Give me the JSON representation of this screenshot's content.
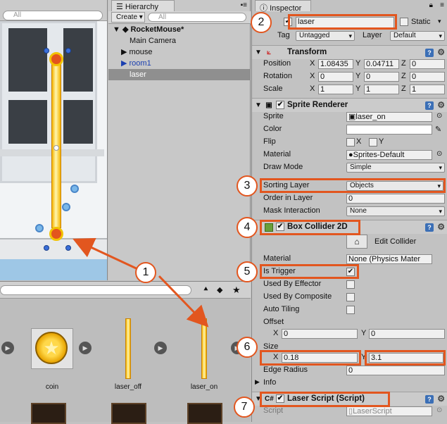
{
  "scene": {
    "search_placeholder": "All"
  },
  "hierarchy": {
    "tab": "Hierarchy",
    "create_label": "Create ▾",
    "search_placeholder": "All",
    "items": [
      {
        "label": "RocketMouse*"
      },
      {
        "label": "Main Camera"
      },
      {
        "label": "mouse"
      },
      {
        "label": "room1"
      },
      {
        "label": "laser"
      }
    ]
  },
  "project": {
    "assets": [
      {
        "label": "coin"
      },
      {
        "label": "laser_off"
      },
      {
        "label": "laser_on"
      }
    ]
  },
  "inspector": {
    "tab": "Inspector",
    "name": "laser",
    "static_label": "Static",
    "tag_label": "Tag",
    "tag_value": "Untagged",
    "layer_label": "Layer",
    "layer_value": "Default",
    "transform": {
      "title": "Transform",
      "position_label": "Position",
      "rotation_label": "Rotation",
      "scale_label": "Scale",
      "position": [
        "1.08435",
        "0.04711",
        "0"
      ],
      "rotation": [
        "0",
        "0",
        "0"
      ],
      "scale": [
        "1",
        "1",
        "1"
      ]
    },
    "axes": [
      "X",
      "Y",
      "Z"
    ],
    "sprite_renderer": {
      "title": "Sprite Renderer",
      "sprite_label": "Sprite",
      "sprite_value": "laser_on",
      "color_label": "Color",
      "flip_label": "Flip",
      "material_label": "Material",
      "material_value": "Sprites-Default",
      "draw_mode_label": "Draw Mode",
      "draw_mode_value": "Simple",
      "sorting_layer_label": "Sorting Layer",
      "sorting_layer_value": "Objects",
      "order_label": "Order in Layer",
      "order_value": "0",
      "mask_label": "Mask Interaction",
      "mask_value": "None"
    },
    "box_collider": {
      "title": "Box Collider 2D",
      "edit_label": "Edit Collider",
      "material_label": "Material",
      "material_value": "None (Physics Mater",
      "is_trigger_label": "Is Trigger",
      "used_by_effector_label": "Used By Effector",
      "used_by_composite_label": "Used By Composite",
      "auto_tiling_label": "Auto Tiling",
      "offset_label": "Offset",
      "offset": [
        "0",
        "0"
      ],
      "size_label": "Size",
      "size": [
        "0.18",
        "3.1"
      ],
      "edge_radius_label": "Edge Radius",
      "edge_radius_value": "0",
      "info_label": "Info"
    },
    "laser_script": {
      "title": "Laser Script (Script)",
      "script_label": "Script",
      "script_value": "LaserScript"
    }
  },
  "annotations": [
    "1",
    "2",
    "3",
    "4",
    "5",
    "6",
    "7"
  ],
  "colors": {
    "highlight": "#e2561f",
    "selection": "#8f8f8f"
  }
}
